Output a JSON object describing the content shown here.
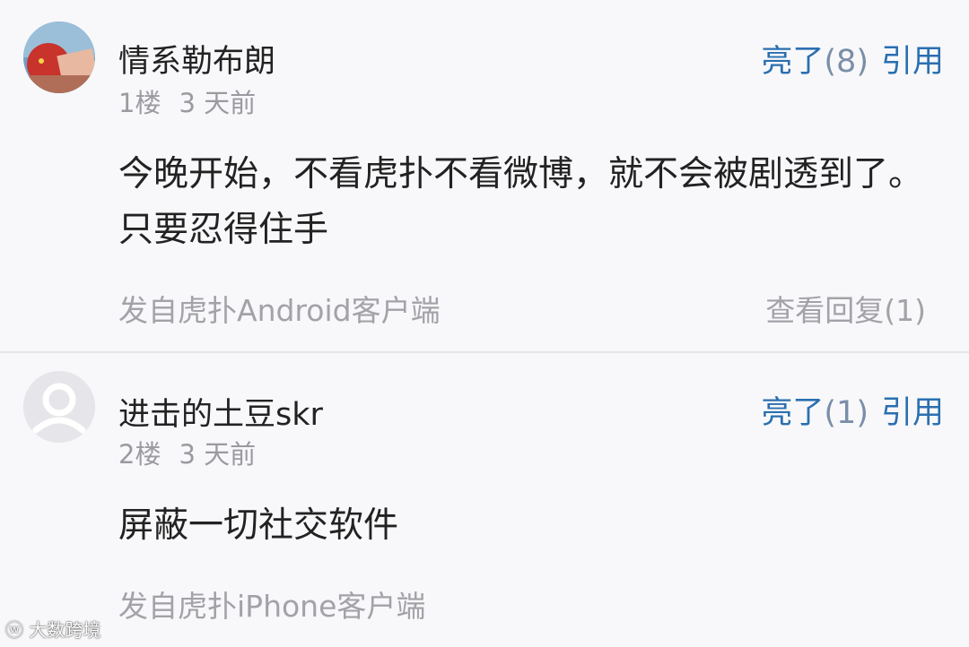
{
  "comments": [
    {
      "username": "情系勒布朗",
      "floor": "1楼",
      "time": "3 天前",
      "like_label": "亮了",
      "like_count": "(8)",
      "quote_label": "引用",
      "text": "今晚开始，不看虎扑不看微博，就不会被剧透到了。只要忍得住手",
      "source": "发自虎扑Android客户端",
      "view_replies": "查看回复(1)"
    },
    {
      "username": "进击的土豆skr",
      "floor": "2楼",
      "time": "3 天前",
      "like_label": "亮了",
      "like_count": "(1)",
      "quote_label": "引用",
      "text": "屏蔽一切社交软件",
      "source": "发自虎扑iPhone客户端"
    }
  ],
  "watermark": "大数跨境",
  "colors": {
    "accent": "#2a6fb0",
    "meta": "#9a9aa0",
    "text": "#222222"
  }
}
